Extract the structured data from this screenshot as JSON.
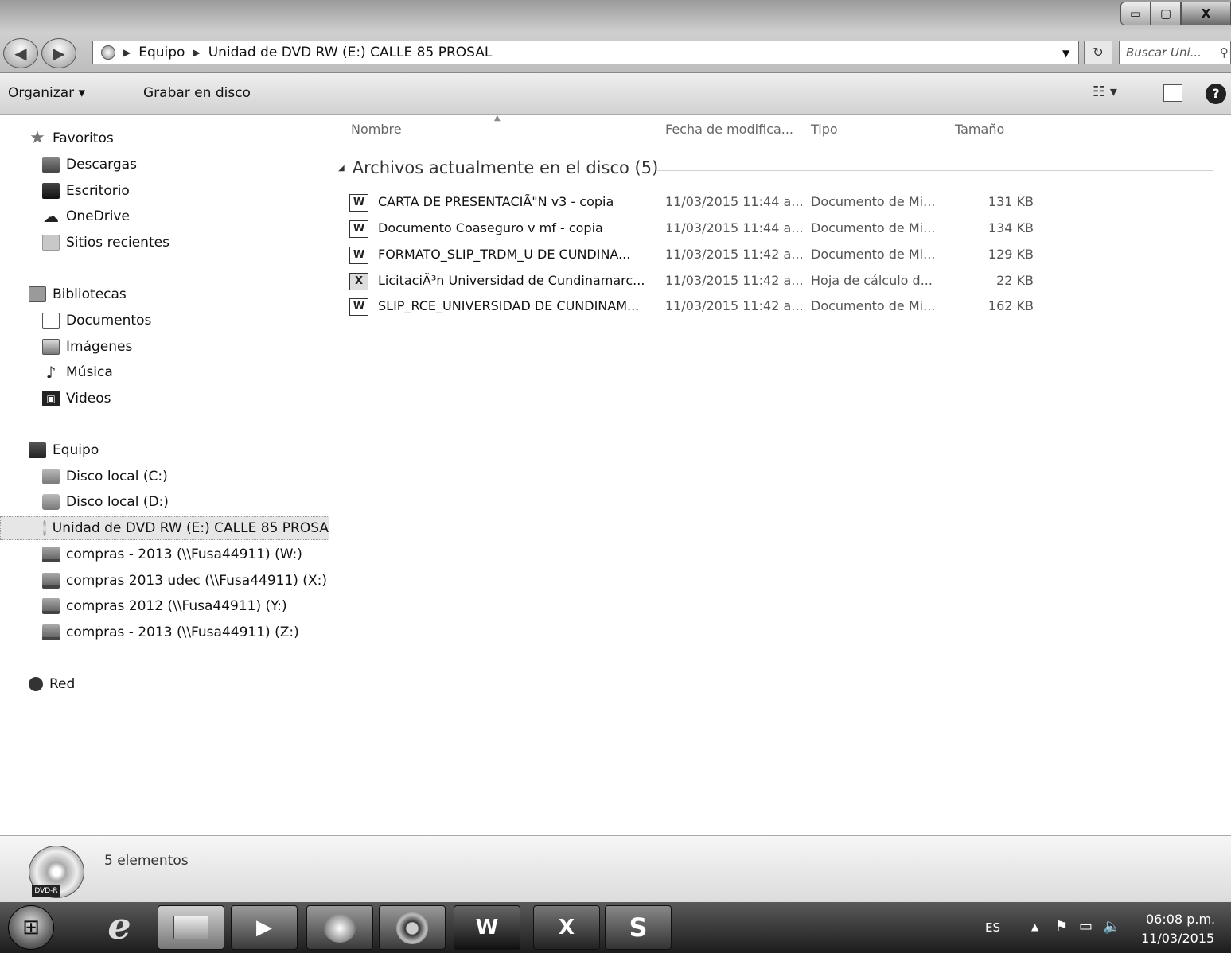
{
  "window": {
    "back_icon": "back-arrow-icon",
    "forward_icon": "forward-arrow-icon",
    "address": {
      "crumbs": [
        "Equipo",
        "Unidad de DVD RW (E:) CALLE 85 PROSAL"
      ]
    },
    "search_placeholder": "Buscar Uni...",
    "controls": {
      "minimize": "▭",
      "maximize": "▢",
      "close": "X"
    }
  },
  "toolbar": {
    "organize_label": "Organizar ▾",
    "burn_label": "Grabar en disco",
    "views_label": "☷ ▾",
    "help_label": "?"
  },
  "nav": {
    "favorites": {
      "label": "Favoritos",
      "items": [
        "Descargas",
        "Escritorio",
        "OneDrive",
        "Sitios recientes"
      ]
    },
    "libraries": {
      "label": "Bibliotecas",
      "items": [
        "Documentos",
        "Imágenes",
        "Música",
        "Videos"
      ]
    },
    "computer": {
      "label": "Equipo",
      "items": [
        "Disco local (C:)",
        "Disco local (D:)",
        "Unidad de DVD RW (E:) CALLE 85 PROSA",
        "compras - 2013 (\\\\Fusa44911) (W:)",
        "compras 2013 udec (\\\\Fusa44911) (X:)",
        "compras 2012 (\\\\Fusa44911) (Y:)",
        "compras - 2013 (\\\\Fusa44911) (Z:)"
      ],
      "selected_index": 2
    },
    "network": {
      "label": "Red"
    }
  },
  "list": {
    "columns": {
      "name": "Nombre",
      "date": "Fecha de modifica...",
      "type": "Tipo",
      "size": "Tamaño"
    },
    "group_label": "Archivos actualmente en el disco (5)",
    "files": [
      {
        "icon": "word-doc-icon",
        "glyph": "W",
        "name": "CARTA DE PRESENTACIÃ\"N v3 - copia",
        "date": "11/03/2015 11:44 a...",
        "type": "Documento de Mi...",
        "size": "131 KB"
      },
      {
        "icon": "word-doc-icon",
        "glyph": "W",
        "name": "Documento Coaseguro v mf - copia",
        "date": "11/03/2015 11:44 a...",
        "type": "Documento de Mi...",
        "size": "134 KB"
      },
      {
        "icon": "word-doc-icon",
        "glyph": "W",
        "name": "FORMATO_SLIP_TRDM_U DE CUNDINA...",
        "date": "11/03/2015 11:42 a...",
        "type": "Documento de Mi...",
        "size": "129 KB"
      },
      {
        "icon": "excel-sheet-icon",
        "glyph": "X",
        "name": "LicitaciÃ³n Universidad de Cundinamarc...",
        "date": "11/03/2015 11:42 a...",
        "type": "Hoja de cálculo d...",
        "size": "22 KB"
      },
      {
        "icon": "word-doc-icon",
        "glyph": "W",
        "name": "SLIP_RCE_UNIVERSIDAD DE CUNDINAM...",
        "date": "11/03/2015 11:42 a...",
        "type": "Documento de Mi...",
        "size": "162 KB"
      }
    ]
  },
  "details": {
    "count": "5 elementos",
    "badge": "DVD-R"
  },
  "taskbar": {
    "apps": [
      {
        "name": "internet-explorer",
        "glyph": "e"
      },
      {
        "name": "windows-explorer",
        "glyph": ""
      },
      {
        "name": "media-player",
        "glyph": "▶"
      },
      {
        "name": "paint",
        "glyph": ""
      },
      {
        "name": "chrome",
        "glyph": ""
      },
      {
        "name": "word",
        "glyph": "W"
      },
      {
        "name": "excel",
        "glyph": "X"
      },
      {
        "name": "skype",
        "glyph": "S"
      }
    ],
    "tray": {
      "language": "ES",
      "time": "06:08 p.m.",
      "date": "11/03/2015"
    }
  }
}
